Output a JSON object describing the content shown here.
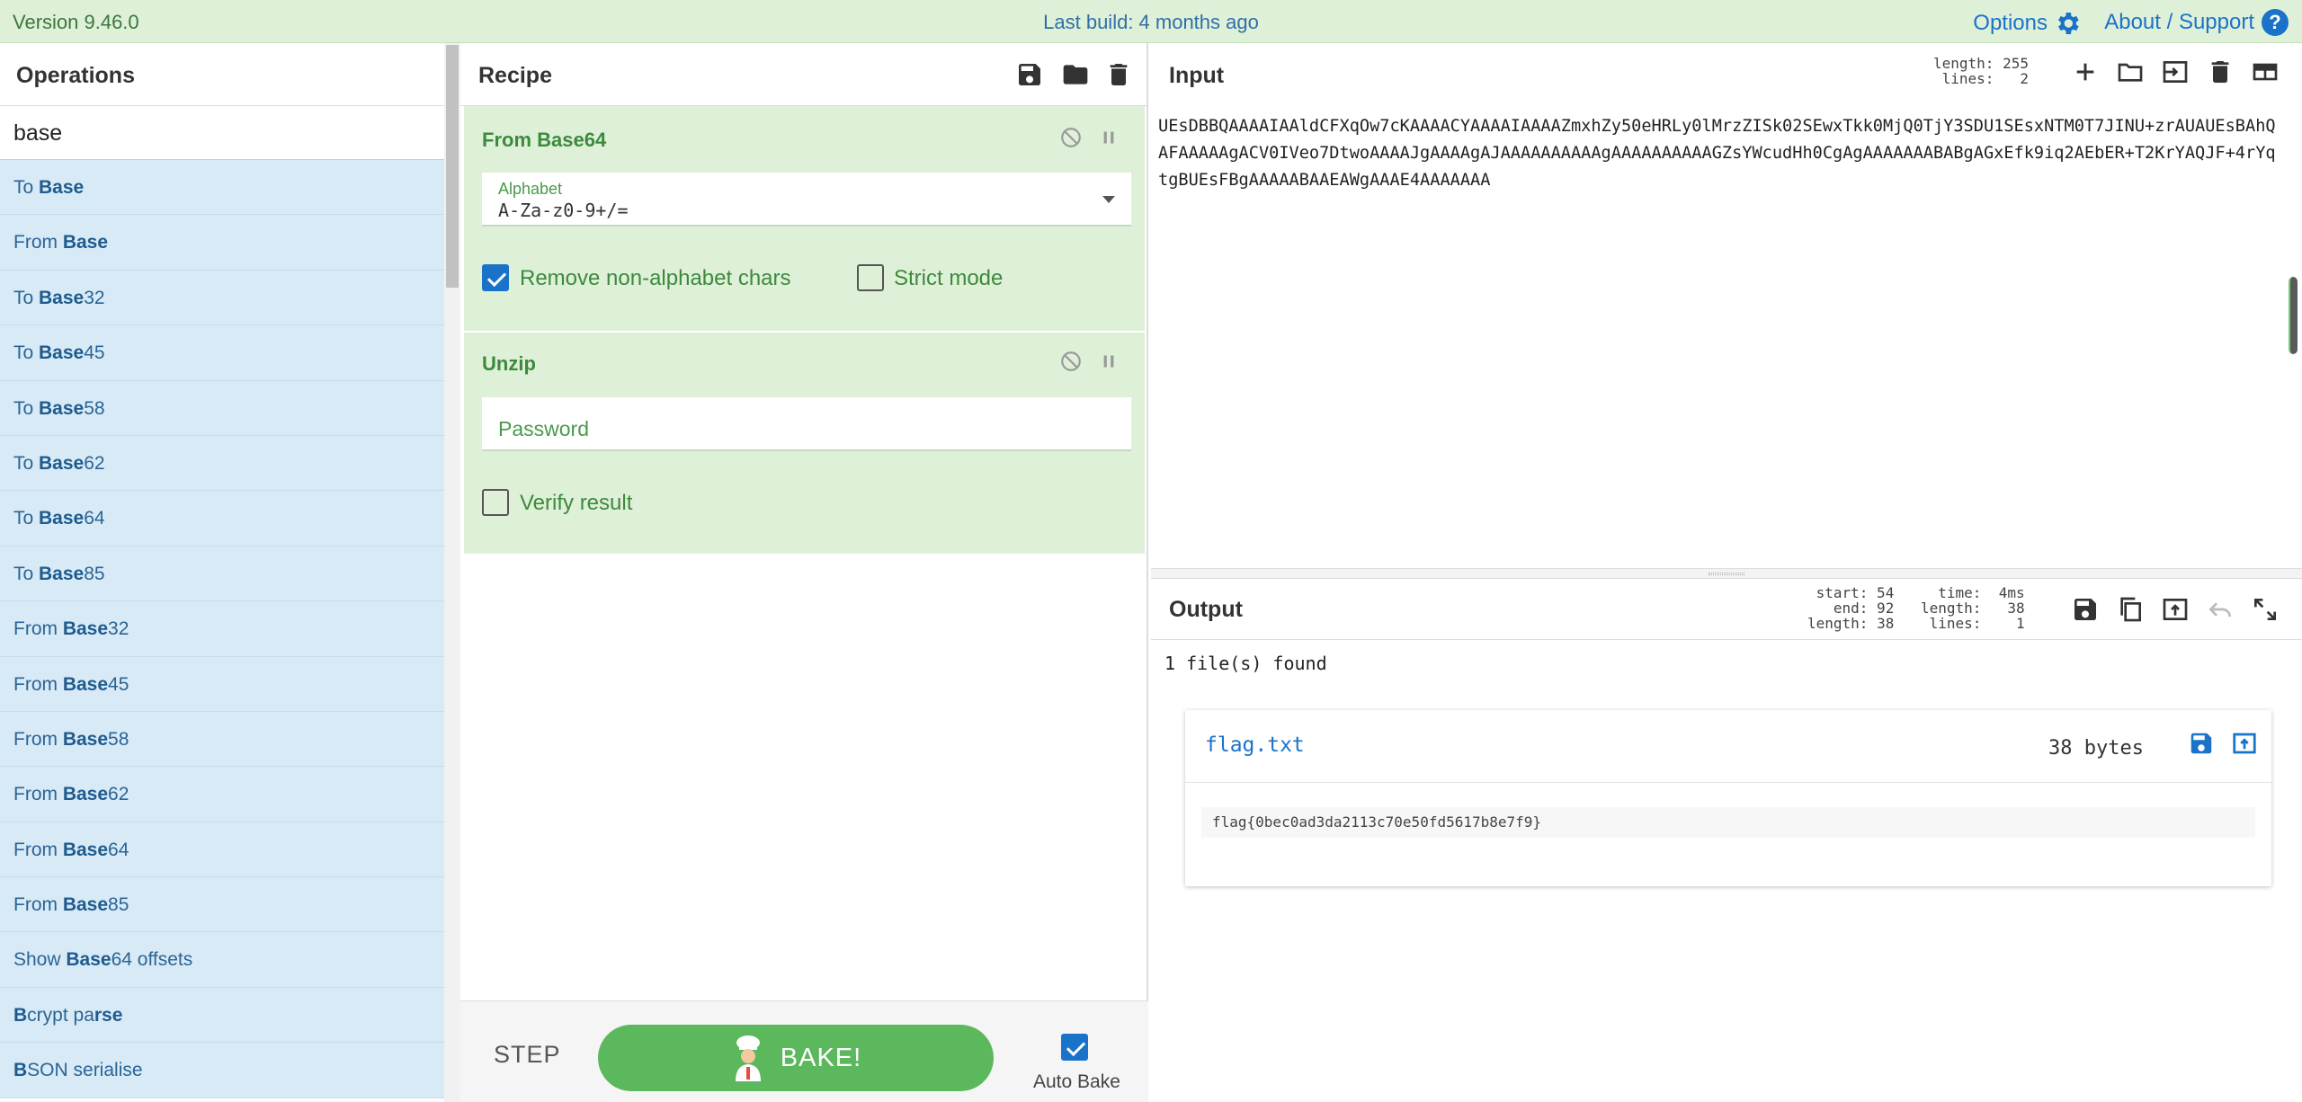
{
  "banner": {
    "version": "Version 9.46.0",
    "last_build": "Last build: 4 months ago",
    "options": "Options",
    "about": "About / Support",
    "help_glyph": "?"
  },
  "operations": {
    "title": "Operations",
    "search_value": "base",
    "items": [
      {
        "pre": "To ",
        "match": "Base",
        "post": ""
      },
      {
        "pre": "From ",
        "match": "Base",
        "post": ""
      },
      {
        "pre": "To ",
        "match": "Base",
        "post": "32"
      },
      {
        "pre": "To ",
        "match": "Base",
        "post": "45"
      },
      {
        "pre": "To ",
        "match": "Base",
        "post": "58"
      },
      {
        "pre": "To ",
        "match": "Base",
        "post": "62"
      },
      {
        "pre": "To ",
        "match": "Base",
        "post": "64"
      },
      {
        "pre": "To ",
        "match": "Base",
        "post": "85"
      },
      {
        "pre": "From ",
        "match": "Base",
        "post": "32"
      },
      {
        "pre": "From ",
        "match": "Base",
        "post": "45"
      },
      {
        "pre": "From ",
        "match": "Base",
        "post": "58"
      },
      {
        "pre": "From ",
        "match": "Base",
        "post": "62"
      },
      {
        "pre": "From ",
        "match": "Base",
        "post": "64"
      },
      {
        "pre": "From ",
        "match": "Base",
        "post": "85"
      },
      {
        "pre": "Show ",
        "match": "Base",
        "post": "64 offsets"
      },
      {
        "pre": "",
        "match": "B",
        "post": "crypt pa",
        "match2": "rse",
        "post2": ""
      },
      {
        "pre": "",
        "match": "B",
        "post": "SON serialise"
      }
    ]
  },
  "recipe": {
    "title": "Recipe",
    "from_base64": {
      "name": "From Base64",
      "alphabet_label": "Alphabet",
      "alphabet_value": "A-Za-z0-9+/=",
      "remove_non_alphabet_label": "Remove non-alphabet chars",
      "remove_non_alphabet_checked": true,
      "strict_mode_label": "Strict mode",
      "strict_mode_checked": false
    },
    "unzip": {
      "name": "Unzip",
      "password_placeholder": "Password",
      "verify_label": "Verify result",
      "verify_checked": false
    },
    "step_label": "STEP",
    "bake_label": "BAKE!",
    "auto_bake_label": "Auto Bake",
    "auto_bake_checked": true
  },
  "input": {
    "title": "Input",
    "stats": "length: 255\n lines:   2",
    "text": "UEsDBBQAAAAIAAldCFXqOw7cKAAAACYAAAAIAAAAZmxhZy50eHRLy0lMrzZISk02SEwxTkk0MjQ0TjY3SDU1SEsxNTM0T7JINU+zrAUAUEsBAhQAFAAAAAgACV0IVeo7DtwoAAAAJgAAAAgAJAAAAAAAAAAgAAAAAAAAAAGZsYWcudHh0CgAgAAAAAAABABgAGxEfk9iq2AEbER+T2KrYAQJF+4rYqtgBUEsFBgAAAAABAAEAWgAAAE4AAAAAAA"
  },
  "output": {
    "title": "Output",
    "stats_left": "start: 54\n  end: 92\nlength: 38",
    "stats_right": "  time:  4ms\nlength:   38\n lines:    1",
    "summary": "1 file(s) found",
    "file_name": "flag.txt",
    "file_size": "38 bytes",
    "file_content": "flag{0bec0ad3da2113c70e50fd5617b8e7f9}"
  },
  "colors": {
    "accent": "#1a73c9",
    "bake": "#5cb85c",
    "recipe_op_bg": "#dff0d8",
    "ops_item_bg": "#d8eaf6"
  }
}
